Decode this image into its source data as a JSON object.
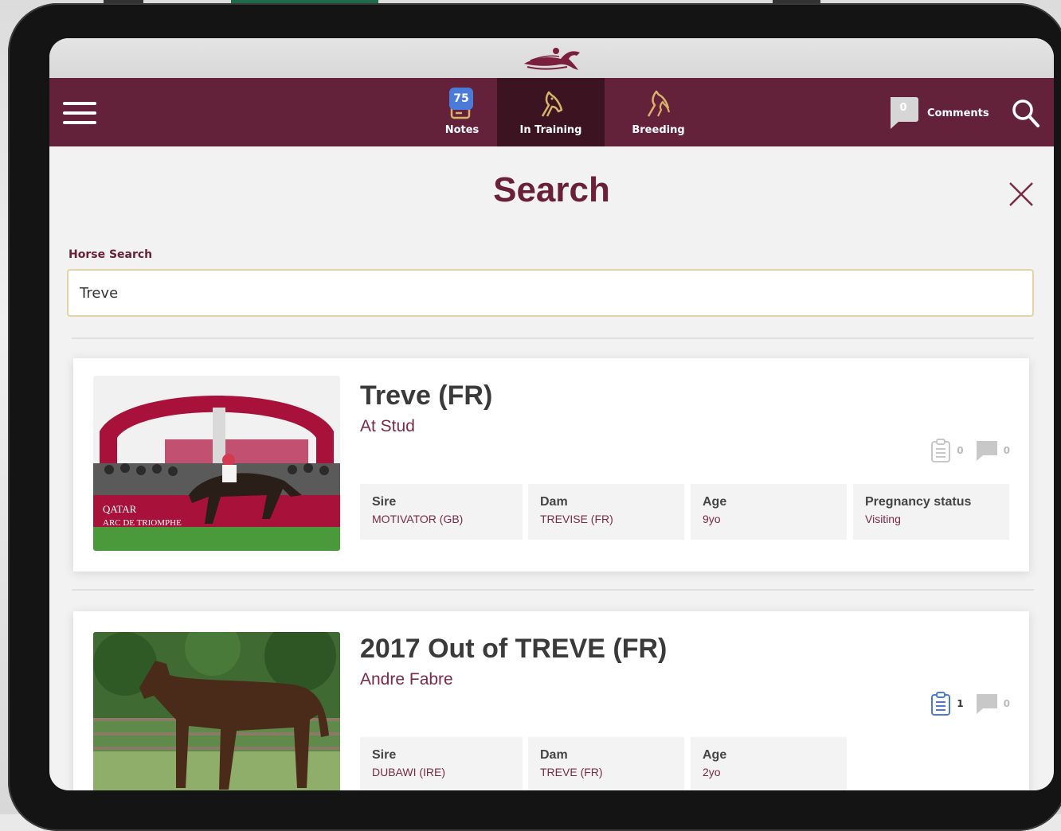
{
  "nav": {
    "notes_label": "Notes",
    "notes_badge": "75",
    "training_label": "In Training",
    "breeding_label": "Breeding",
    "comments_count": "0",
    "comments_label": "Comments",
    "active_tab": "In Training"
  },
  "page": {
    "title": "Search"
  },
  "search": {
    "label": "Horse Search",
    "value": "Treve"
  },
  "results": [
    {
      "name": "Treve (FR)",
      "subtitle": "At Stud",
      "notes_count": "0",
      "comments_count": "0",
      "fields": [
        {
          "key": "Sire",
          "value": "MOTIVATOR (GB)"
        },
        {
          "key": "Dam",
          "value": "TREVISE (FR)"
        },
        {
          "key": "Age",
          "value": "9yo"
        },
        {
          "key": "Pregnancy status",
          "value": "Visiting"
        }
      ],
      "photo_banner": [
        "QATAR",
        "ARC DE TRIOMPHE"
      ]
    },
    {
      "name": "2017 Out of TREVE (FR)",
      "subtitle": "Andre Fabre",
      "notes_count": "1",
      "comments_count": "0",
      "fields": [
        {
          "key": "Sire",
          "value": "DUBAWI (IRE)"
        },
        {
          "key": "Dam",
          "value": "TREVE (FR)"
        },
        {
          "key": "Age",
          "value": "2yo"
        }
      ]
    }
  ],
  "colors": {
    "brand": "#64213a",
    "brand_dark": "#3b1321",
    "accent_gold": "#d8b36a",
    "badge_blue": "#4a7bd9"
  }
}
